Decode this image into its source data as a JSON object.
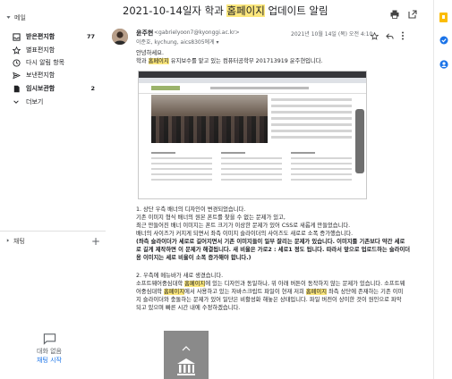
{
  "mail": {
    "header_label": "메일",
    "folders": [
      {
        "label": "받은편지함",
        "count": "77",
        "bold": true,
        "icon": "inbox-icon"
      },
      {
        "label": "별표편지함",
        "count": "",
        "bold": false,
        "icon": "star-icon"
      },
      {
        "label": "다시 알림 항목",
        "count": "",
        "bold": false,
        "icon": "clock-icon"
      },
      {
        "label": "보낸편지함",
        "count": "",
        "bold": false,
        "icon": "send-icon"
      },
      {
        "label": "임시보관함",
        "count": "2",
        "bold": true,
        "icon": "draft-icon"
      },
      {
        "label": "더보기",
        "count": "",
        "bold": false,
        "icon": "chevron-down-icon"
      }
    ]
  },
  "chat": {
    "header_label": "채팅",
    "empty_label": "대화 없음",
    "start_label": "채팅 시작"
  },
  "message": {
    "subject_prefix": "2021-10-14일자 학과 ",
    "subject_highlight": "홈페이지",
    "subject_suffix": " 업데이트 알림",
    "sender_name": "윤주현",
    "sender_email": "<gabrielyoon7@kyonggi.ac.kr>",
    "to_line": "이준호, kychung, aics8305에게 ▾",
    "date": "2021년 10월 14일 (목) 오전 4:10",
    "body": {
      "greeting": "안녕하세요.",
      "intro_pre": "학과 ",
      "intro_hl": "홈페이지",
      "intro_post": " 유지보수를 맡고 있는 컴퓨터공학부 201713919 윤주현입니다.",
      "p1_l1": "1. 상단 우측 배너의 디자인이 변경되었습니다.",
      "p1_l2": "기존 이미지 형식 배너의 원본 폰트를 찾을 수 없는 문제가 있고,",
      "p1_l3": "최근 만들어진 배너 이미지는 폰트 크기가 이상한 문제가 있어 CSS로 새롭게 만들었습니다.",
      "p1_l4": "배너의 사이즈가 커지게 되면서 좌측 이미지 슬라이더의 사이즈도 새로로 소폭 증가했습니다.",
      "p1_b1": "(좌측 슬라이더가 세로로 길어지면서 기존 이미지들이 일부 잘리는 문제가 있습니다. 이미지를 기존보다 약간 세로",
      "p1_b2": "로 길게 제작하면 이 문제가 해결됩니다. 새 비율은 가로2 : 세로1 정도 됩니다. 따라서 앞으로 업로드하는 슬라이더",
      "p1_b3": "용 이미지는 세로 비율이 소폭 증가해야 합니다.)",
      "p2_l1": "2. 우측에 메뉴바가 새로 생겼습니다.",
      "p2_l2_pre": "소프트웨어중심대학 ",
      "p2_l2_hl": "홈페이지",
      "p2_l2_post": "에 있는 디자인과 동일하나, 위 아래 버튼이 동작하지 않는 문제가 있습니다. 소프트웨",
      "p2_l3_pre": "어중심대학 ",
      "p2_l3_hl": "홈페이지",
      "p2_l3_post": "에서 사용하고 있는 자바스크립트 파일이 현재 저희 ",
      "p2_l3_hl2": "홈페이지",
      "p2_l3_post2": " 좌측 상단에 존재하는 기존 이미",
      "p2_l4": "지 슬라이더와 충돌하는 문제가 있어 일단은 비활성화 해놓은 상태입니다. 파일 버전이 상이한 것이 원인으로 파악",
      "p2_l5": "되고 있으며 빠른 시간 내에 수정하겠습니다."
    }
  },
  "colors": {
    "highlight": "#fce77c",
    "link": "#1a73e8",
    "text": "#202124",
    "muted": "#5f6368"
  }
}
